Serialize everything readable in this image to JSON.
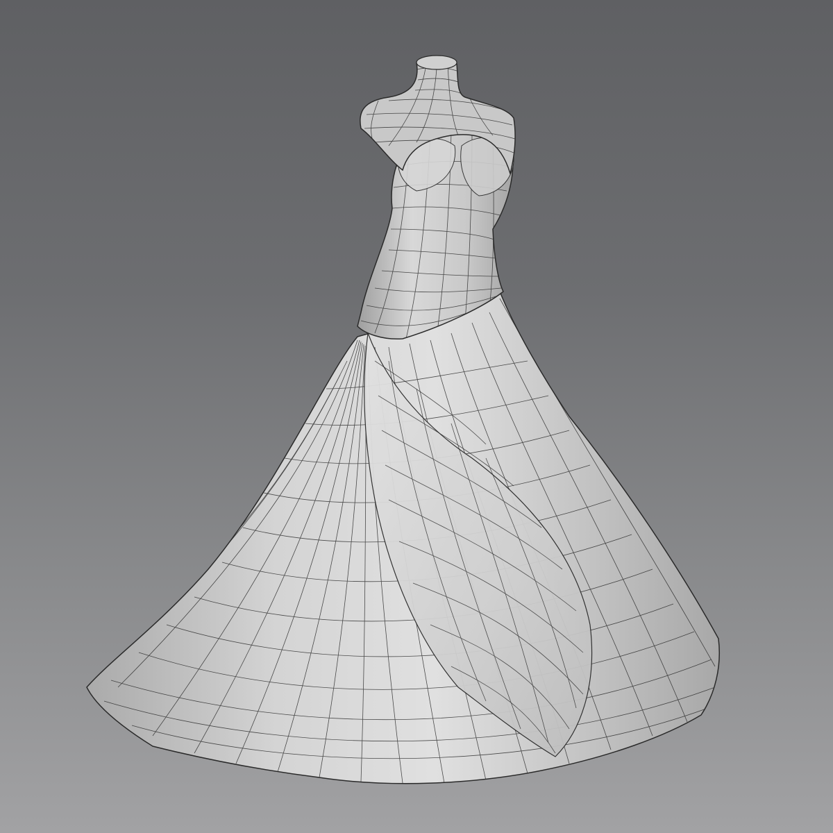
{
  "scene": {
    "subject": "wedding-gown-wireframe-model",
    "background_top": "#5f6063",
    "background_bottom": "#a2a2a4",
    "surface_color": "#cfcfcf",
    "shadow_color": "#9a9a9a",
    "wire_color": "#2a2a2a"
  }
}
